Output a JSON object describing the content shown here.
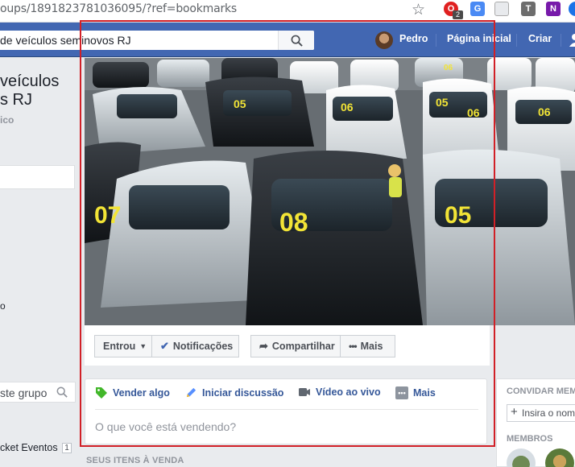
{
  "browser": {
    "url": "oups/1891823781036095/?ref=bookmarks",
    "ext_badge": "2",
    "ext_letters": [
      "T",
      "N"
    ]
  },
  "topbar": {
    "search_value": "de veículos seminovos RJ",
    "user_name": "Pedro",
    "home_label": "Página inicial",
    "create_label": "Criar"
  },
  "left": {
    "group_title": "veículos\ns RJ",
    "privacy": "ico",
    "fragment": "o",
    "search_placeholder": "ste grupo",
    "event_label": "cket Eventos",
    "event_count": "1"
  },
  "actions": {
    "joined": "Entrou",
    "notifications": "Notificações",
    "share": "Compartilhar",
    "more": "Mais"
  },
  "composer": {
    "tabs": [
      "Vender algo",
      "Iniciar discussão",
      "Vídeo ao vivo",
      "Mais"
    ],
    "prompt": "O que você está vendendo?"
  },
  "section": {
    "items_for_sale": "SEUS ITENS À VENDA"
  },
  "right": {
    "invite_title": "CONVIDAR MEM",
    "invite_placeholder": "Insira o nome",
    "members_title": "MEMBROS"
  },
  "cover": {
    "plate_numbers": [
      "07",
      "08",
      "05",
      "06",
      "05",
      "06",
      "05",
      "06",
      "06"
    ]
  },
  "colors": {
    "fb_blue": "#4267b2",
    "link_blue": "#365899",
    "highlight_red": "#d12027"
  }
}
